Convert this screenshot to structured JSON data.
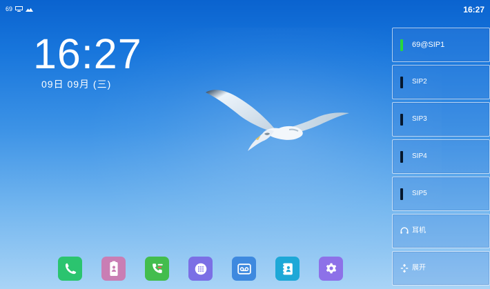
{
  "status_bar": {
    "account_number": "69",
    "clock": "16:27"
  },
  "clock_widget": {
    "time": "16:27",
    "date": "09日 09月 (三)"
  },
  "line_keys": [
    {
      "label": "69@SIP1",
      "active": true
    },
    {
      "label": "SIP2",
      "active": false
    },
    {
      "label": "SIP3",
      "active": false
    },
    {
      "label": "SIP4",
      "active": false
    },
    {
      "label": "SIP5",
      "active": false
    },
    {
      "label": "耳机",
      "icon": "headset-icon"
    },
    {
      "label": "展开",
      "icon": "expand-icon"
    }
  ],
  "dock": {
    "items": [
      {
        "icon": "phone-icon",
        "color": "#2bc46f"
      },
      {
        "icon": "contacts-card-icon",
        "color": "#c97eb4"
      },
      {
        "icon": "call-history-icon",
        "color": "#43bd4d"
      },
      {
        "icon": "apps-grid-icon",
        "color": "#7b6fe5"
      },
      {
        "icon": "voicemail-icon",
        "color": "#3e89df"
      },
      {
        "icon": "directory-icon",
        "color": "#1ea8d7"
      },
      {
        "icon": "settings-gear-icon",
        "color": "#8d71e8"
      }
    ]
  }
}
